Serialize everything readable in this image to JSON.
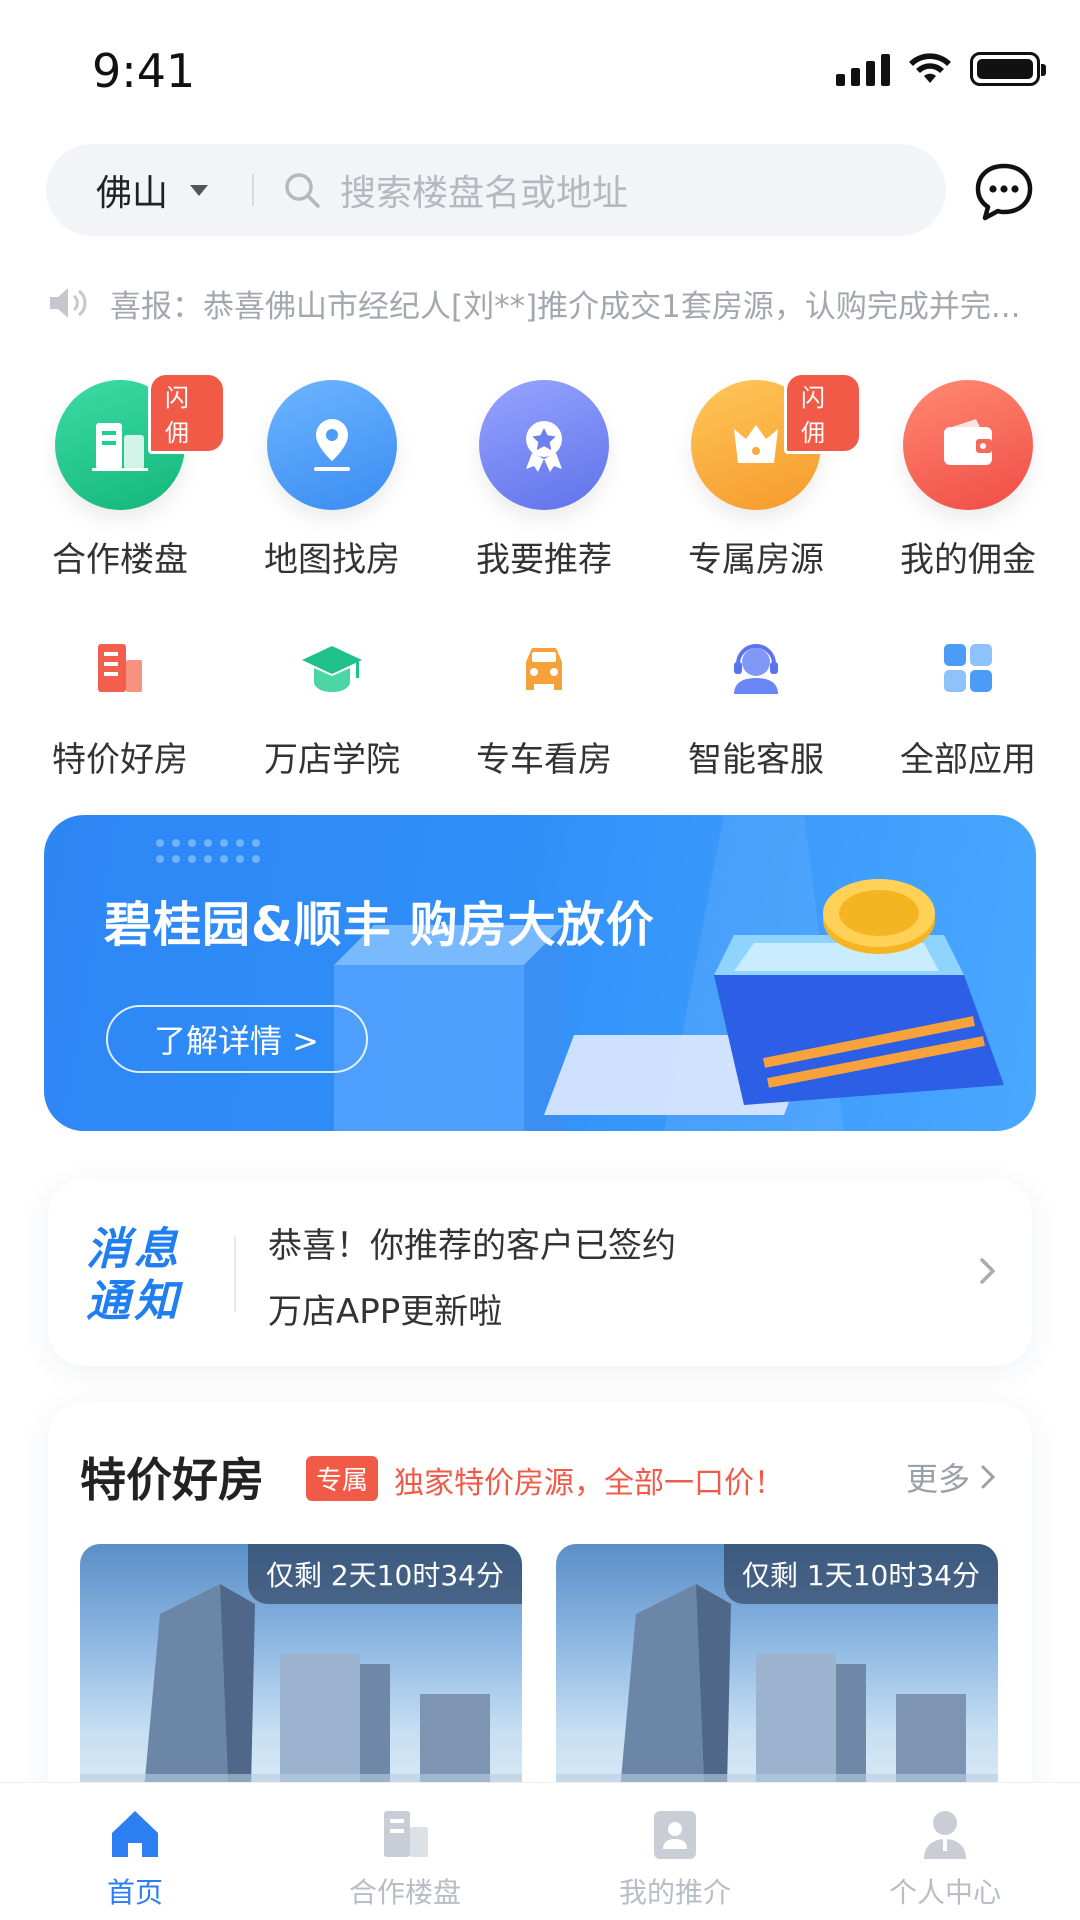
{
  "status_bar": {
    "time": "9:41"
  },
  "search": {
    "city": "佛山",
    "placeholder": "搜索楼盘名或地址"
  },
  "notice": {
    "text": "喜报：恭喜佛山市经纪人[刘**]推介成交1套房源，认购完成并完..."
  },
  "grid_primary": [
    {
      "label": "合作楼盘",
      "badge": "闪佣",
      "icon": "building-icon",
      "color": "#1fcf8f"
    },
    {
      "label": "地图找房",
      "badge": "",
      "icon": "map-pin-icon",
      "color": "#4b9df8"
    },
    {
      "label": "我要推荐",
      "badge": "",
      "icon": "award-icon",
      "color": "#7b8cf5"
    },
    {
      "label": "专属房源",
      "badge": "闪佣",
      "icon": "crown-icon",
      "color": "#f8ac3c"
    },
    {
      "label": "我的佣金",
      "badge": "",
      "icon": "wallet-icon",
      "color": "#f76a5a"
    }
  ],
  "grid_secondary": [
    {
      "label": "特价好房",
      "icon": "discount-building-icon",
      "color": "#f2604d"
    },
    {
      "label": "万店学院",
      "icon": "graduation-cap-icon",
      "color": "#21c08a"
    },
    {
      "label": "专车看房",
      "icon": "car-icon",
      "color": "#f6a23a"
    },
    {
      "label": "智能客服",
      "icon": "customer-service-icon",
      "color": "#6b86f5"
    },
    {
      "label": "全部应用",
      "icon": "apps-grid-icon",
      "color": "#4c9bf6"
    }
  ],
  "banner": {
    "title": "碧桂园&顺丰 购房大放价",
    "button": "了解详情 >"
  },
  "notification": {
    "logo_line1": "消息",
    "logo_line2": "通知",
    "messages": [
      "恭喜！你推荐的客户已签约",
      "万店APP更新啦"
    ]
  },
  "special": {
    "title": "特价好房",
    "tag": "专属",
    "subtitle": "独家特价房源，全部一口价！",
    "more": "更多",
    "houses": [
      {
        "countdown": "仅剩 2天10时34分"
      },
      {
        "countdown": "仅剩 1天10时34分"
      }
    ]
  },
  "tabs": [
    {
      "label": "首页",
      "icon": "home-icon",
      "active": true
    },
    {
      "label": "合作楼盘",
      "icon": "building-icon",
      "active": false
    },
    {
      "label": "我的推介",
      "icon": "profile-card-icon",
      "active": false
    },
    {
      "label": "个人中心",
      "icon": "user-icon",
      "active": false
    }
  ],
  "colors": {
    "accent": "#2c7ff2",
    "badge_red": "#f25a48",
    "muted": "#b9bdc6"
  }
}
